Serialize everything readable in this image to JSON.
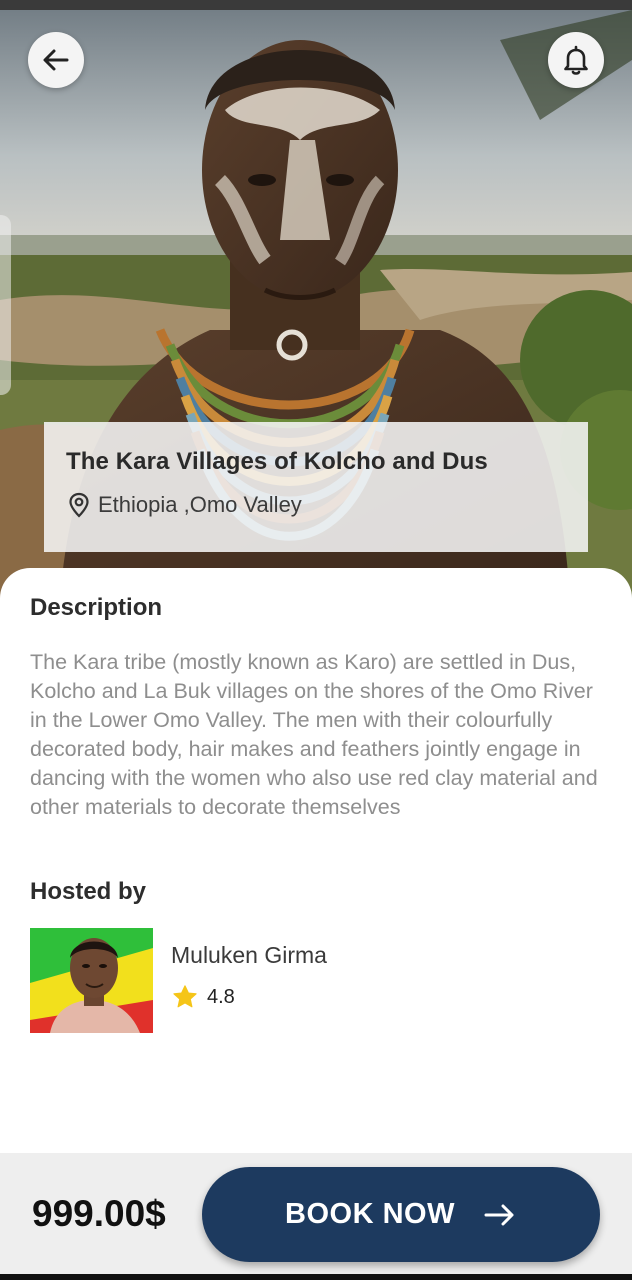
{
  "header": {
    "back_icon": "arrow-left-icon",
    "notification_icon": "bell-icon"
  },
  "tour": {
    "title": "The Kara Villages of Kolcho and Dus",
    "location": "Ethiopia ,Omo Valley",
    "location_icon": "map-pin-icon"
  },
  "description": {
    "heading": "Description",
    "text": "The Kara tribe (mostly known as Karo) are settled in Dus, Kolcho and La Buk villages on the shores of the Omo River in the Lower Omo Valley. The men with their colourfully decorated body, hair makes and feathers jointly engage in dancing with the women who also use red clay material and other materials to decorate themselves"
  },
  "host": {
    "heading": "Hosted by",
    "name": "Muluken Girma",
    "rating": "4.8",
    "rating_icon": "star-icon"
  },
  "booking": {
    "price": "999.00$",
    "button_label": "BOOK NOW",
    "button_icon": "arrow-right-icon"
  },
  "colors": {
    "primary": "#1d3a5f",
    "star": "#f5c518",
    "description_text": "#8e8e8e"
  }
}
